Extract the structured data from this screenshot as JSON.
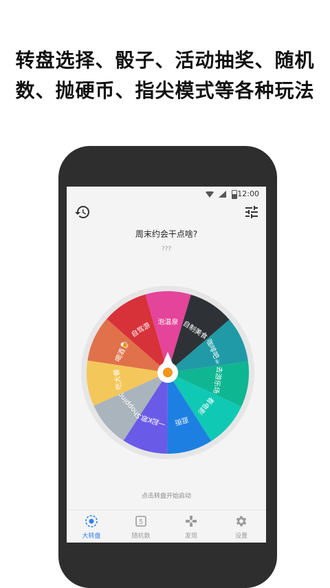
{
  "promo": {
    "line1": "转盘选择、骰子、活动抽奖、随机",
    "line2": "数、抛硬币、指尖模式等各种玩法"
  },
  "status": {
    "time": "12:00"
  },
  "header": {
    "history_icon": "history-icon",
    "settings_icon": "sliders-icon"
  },
  "main": {
    "title": "周末约会干点啥?",
    "result": "???",
    "hint": "点击转盘开始启动"
  },
  "wheel": {
    "segments": [
      {
        "label": "泡温泉",
        "color": "#e4449a"
      },
      {
        "label": "自制美食",
        "color": "#2e3236"
      },
      {
        "label": "咖啡吧☕",
        "color": "#1f9aa6"
      },
      {
        "label": "去游乐场",
        "color": "#0fb692"
      },
      {
        "label": "看电影",
        "color": "#10c9b4"
      },
      {
        "label": "逛街",
        "color": "#1e7fe2"
      },
      {
        "label": "一起K歌",
        "color": "#6a5ae8"
      },
      {
        "label": "Shopping",
        "color": "#aab4bd"
      },
      {
        "label": "吃大餐",
        "color": "#f4c75a"
      },
      {
        "label": "喝酒🍺",
        "color": "#e0714a"
      },
      {
        "label": "自驾游",
        "color": "#d7313a"
      }
    ],
    "center_color": "#f2941c"
  },
  "tabs": [
    {
      "label": "大转盘",
      "icon": "wheel-target-icon",
      "active": true
    },
    {
      "label": "随机数",
      "icon": "dice-number-icon",
      "active": false
    },
    {
      "label": "发现",
      "icon": "gamepad-icon",
      "active": false
    },
    {
      "label": "设置",
      "icon": "gear-icon",
      "active": false
    }
  ],
  "colors": {
    "accent": "#2f80ed",
    "phone_body": "#2e2e2e",
    "screen_bg": "#f4f4f4"
  }
}
